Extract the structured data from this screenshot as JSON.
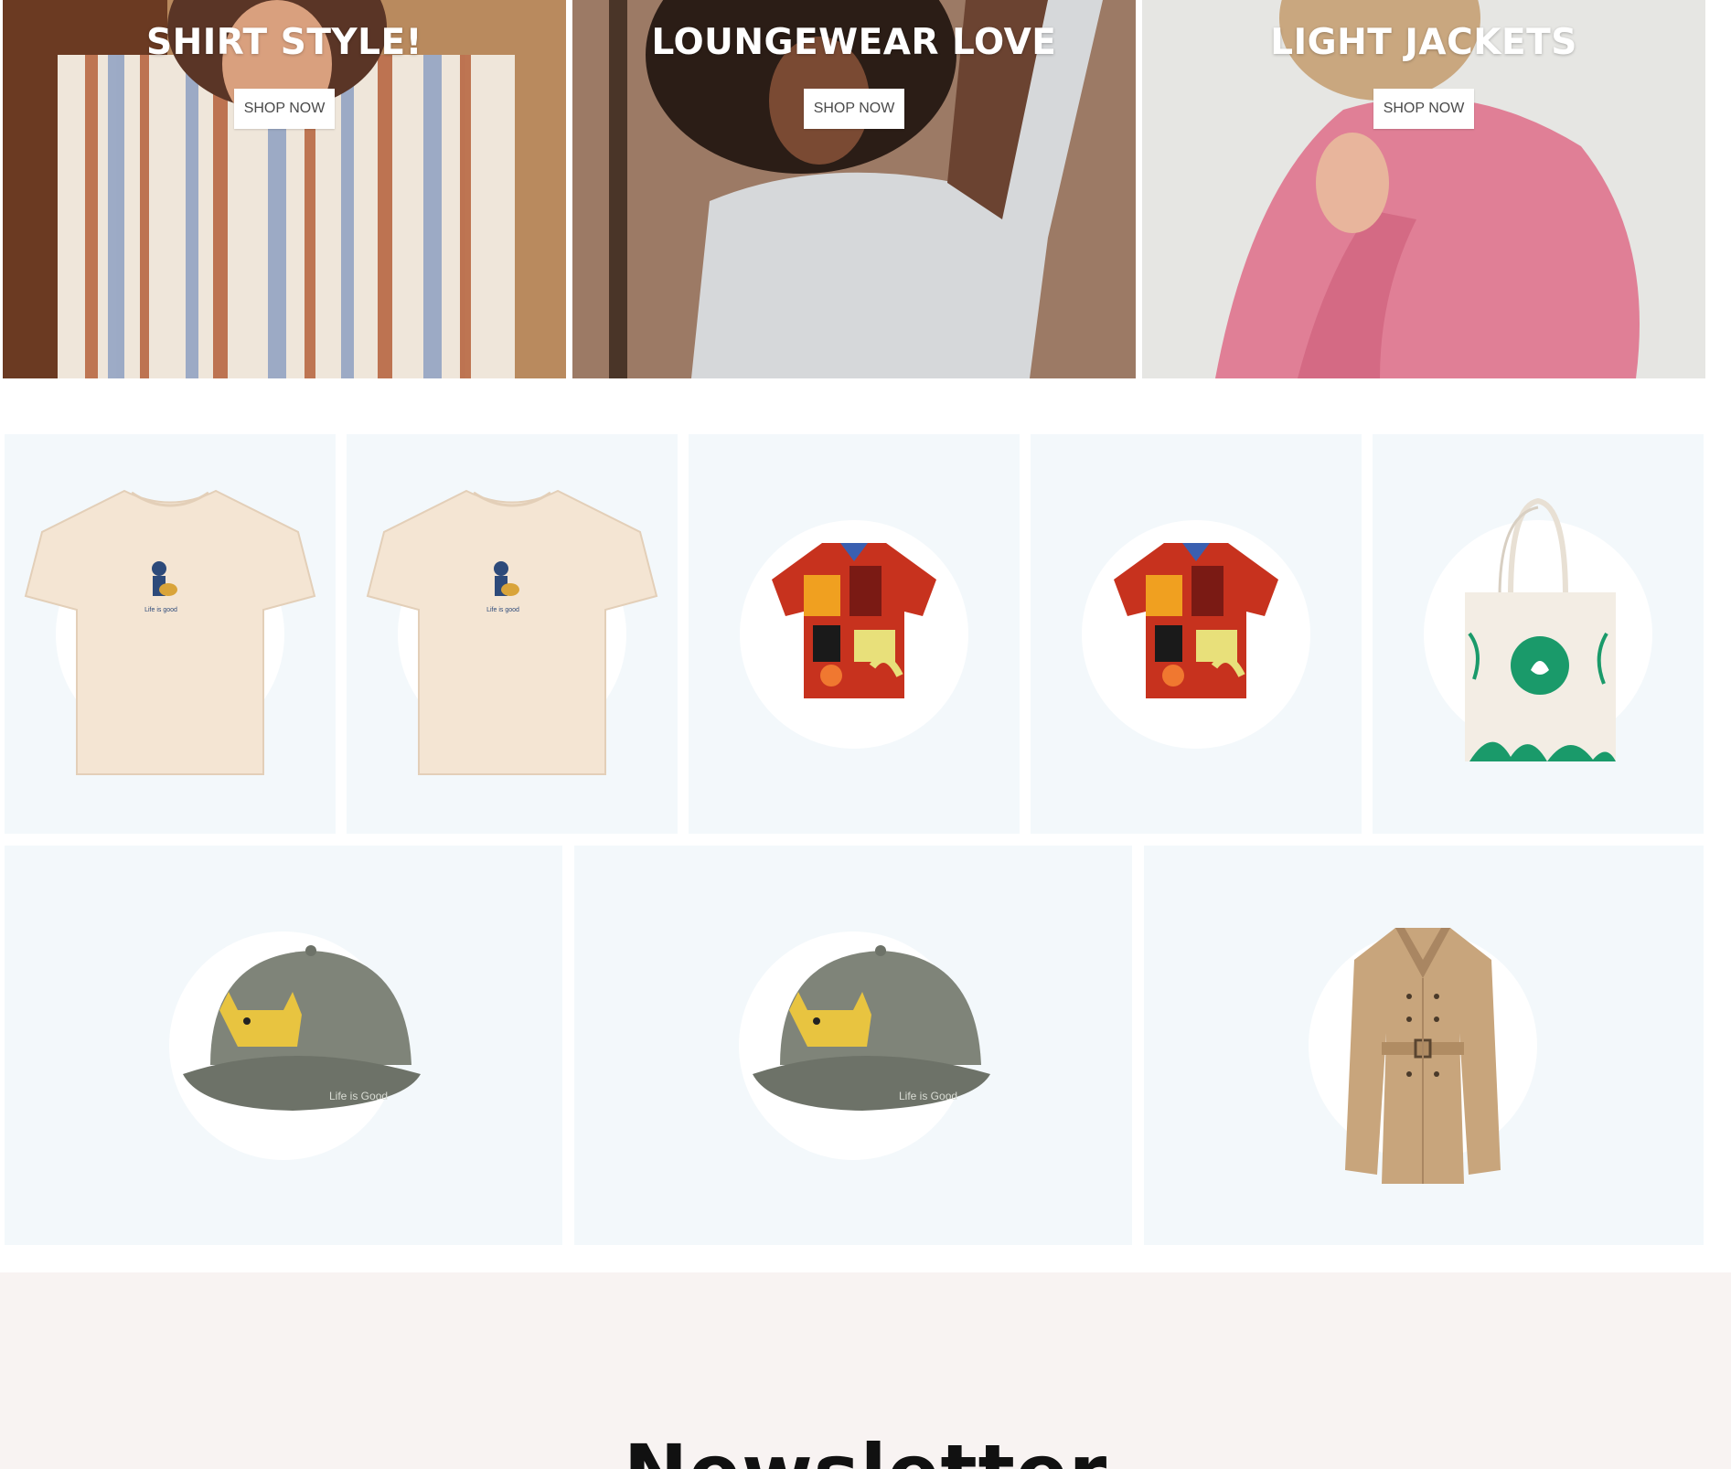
{
  "banners": [
    {
      "title": "SHIRT STYLE!",
      "button": "SHOP NOW"
    },
    {
      "title": "LOUNGEWEAR LOVE",
      "button": "SHOP NOW"
    },
    {
      "title": "LIGHT JACKETS",
      "button": "SHOP NOW"
    }
  ],
  "products": [
    {
      "image": "cream-tshirt"
    },
    {
      "image": "cream-tshirt"
    },
    {
      "image": "patterned-shirt"
    },
    {
      "image": "patterned-shirt"
    },
    {
      "image": "tote-bag"
    },
    {
      "image": "grey-cap"
    },
    {
      "image": "grey-cap"
    },
    {
      "image": "trench-coat"
    }
  ],
  "newsletter": {
    "title": "Newsletter"
  },
  "colors": {
    "tile_background": "#f3f8fb",
    "newsletter_background": "#f8f3f2",
    "banner_text": "#ffffff"
  }
}
